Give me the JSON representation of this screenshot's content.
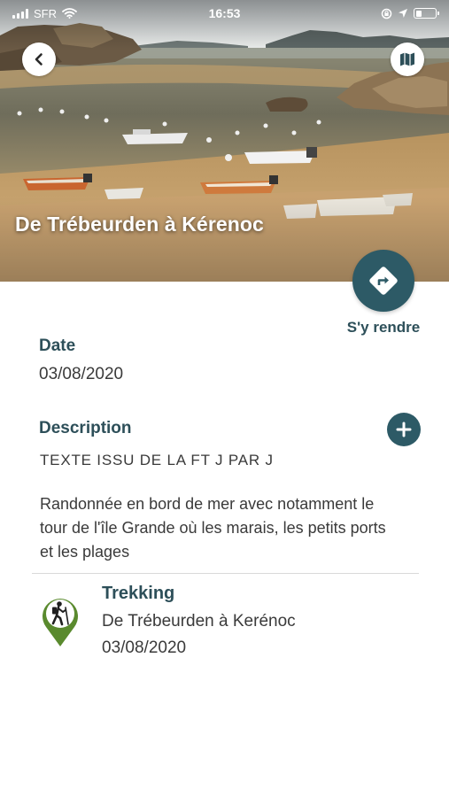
{
  "status_bar": {
    "carrier": "SFR",
    "time": "16:53"
  },
  "hero": {
    "title": "De Trébeurden à Kérenoc",
    "back_icon": "chevron-left-icon",
    "map_icon": "map-icon"
  },
  "directions": {
    "label": "S'y rendre",
    "icon": "directions-icon"
  },
  "date": {
    "title": "Date",
    "value": "03/08/2020"
  },
  "description": {
    "title": "Description",
    "subtitle": "TEXTE ISSU DE LA FT J PAR J",
    "body": "Randonnée en bord de mer avec notamment le tour de l'île Grande où les marais, les petits ports et les plages",
    "expand_icon": "plus-icon"
  },
  "activity": {
    "icon": "trekking-pin-icon",
    "title": "Trekking",
    "name": "De Trébeurden à Kerénoc",
    "date": "03/08/2020"
  },
  "colors": {
    "primary": "#2d5a66",
    "heading": "#2d4f59",
    "pin_green": "#5a8a2e"
  }
}
